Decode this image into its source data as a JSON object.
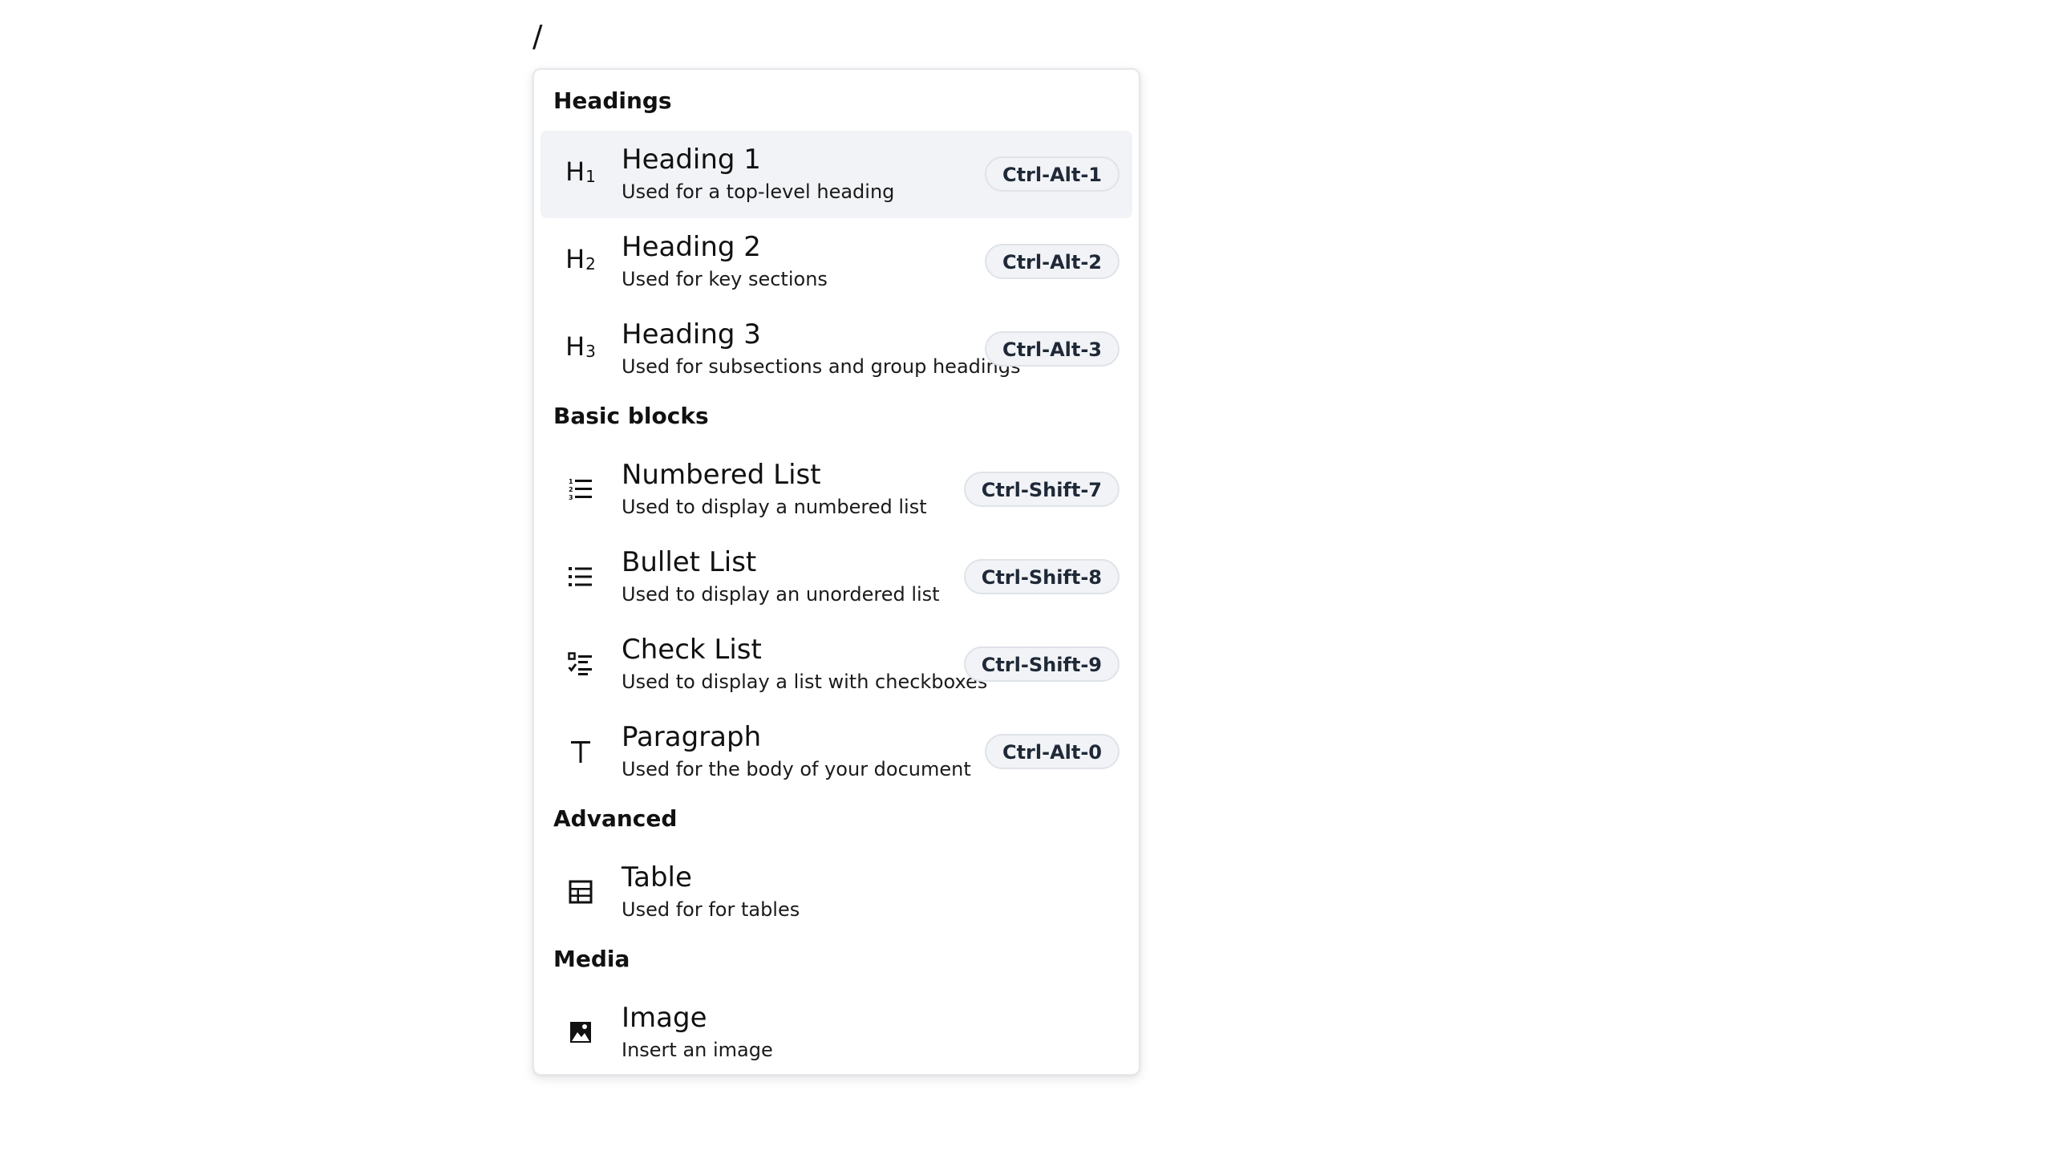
{
  "editor": {
    "text": "/"
  },
  "menu": {
    "groups": [
      {
        "label": "Headings",
        "items": [
          {
            "icon": "heading-1-icon",
            "icon_text": "H",
            "icon_sub": "1",
            "title": "Heading 1",
            "description": "Used for a top-level heading",
            "shortcut": "Ctrl-Alt-1",
            "active": true
          },
          {
            "icon": "heading-2-icon",
            "icon_text": "H",
            "icon_sub": "2",
            "title": "Heading 2",
            "description": "Used for key sections",
            "shortcut": "Ctrl-Alt-2"
          },
          {
            "icon": "heading-3-icon",
            "icon_text": "H",
            "icon_sub": "3",
            "title": "Heading 3",
            "description": "Used for subsections and group headings",
            "shortcut": "Ctrl-Alt-3"
          }
        ]
      },
      {
        "label": "Basic blocks",
        "items": [
          {
            "icon": "numbered-list-icon",
            "title": "Numbered List",
            "description": "Used to display a numbered list",
            "shortcut": "Ctrl-Shift-7"
          },
          {
            "icon": "bullet-list-icon",
            "title": "Bullet List",
            "description": "Used to display an unordered list",
            "shortcut": "Ctrl-Shift-8"
          },
          {
            "icon": "check-list-icon",
            "title": "Check List",
            "description": "Used to display a list with checkboxes",
            "shortcut": "Ctrl-Shift-9"
          },
          {
            "icon": "paragraph-icon",
            "title": "Paragraph",
            "description": "Used for the body of your document",
            "shortcut": "Ctrl-Alt-0"
          }
        ]
      },
      {
        "label": "Advanced",
        "items": [
          {
            "icon": "table-icon",
            "title": "Table",
            "description": "Used for for tables"
          }
        ]
      },
      {
        "label": "Media",
        "items": [
          {
            "icon": "image-icon",
            "title": "Image",
            "description": "Insert an image"
          }
        ]
      }
    ]
  },
  "colors": {
    "active_item_bg": "#f1f3f6",
    "shortcut_bg": "#f1f3f6",
    "border": "#e5e7eb"
  }
}
